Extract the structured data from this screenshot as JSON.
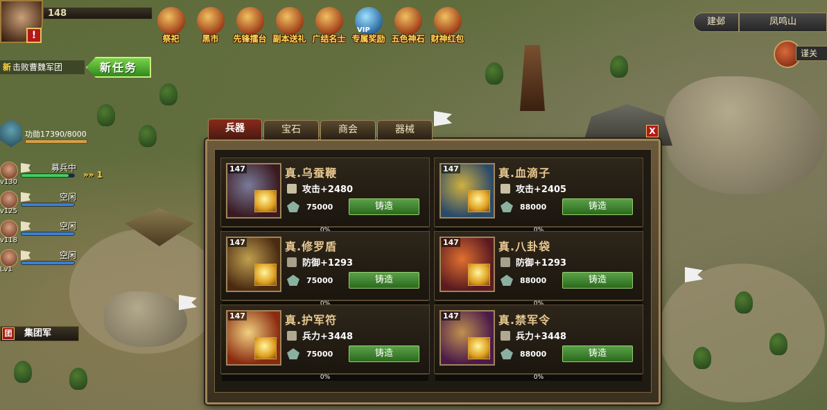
{
  "player": {
    "level": "148",
    "alert_icon": "!"
  },
  "top_icons": [
    {
      "label": "祭祀",
      "icon": "tripod-icon"
    },
    {
      "label": "黑市",
      "icon": "market-icon"
    },
    {
      "label": "先锋擂台",
      "icon": "arena-icon"
    },
    {
      "label": "副本送礼",
      "icon": "gift-icon"
    },
    {
      "label": "广结名士",
      "icon": "lantern-icon"
    },
    {
      "label": "专属奖励",
      "icon": "vip-icon",
      "badge": "VIP"
    },
    {
      "label": "五色神石",
      "icon": "crystal-icon"
    },
    {
      "label": "财神红包",
      "icon": "red-envelope-icon"
    }
  ],
  "location": {
    "button": "建邺",
    "name": "凤鸣山",
    "side_label": "谨关"
  },
  "task": {
    "new_tag": "新",
    "current": "击败曹魏军团",
    "new_task_button": "新任务"
  },
  "merit": {
    "label": "功勋17390/8000",
    "fill": 1.0
  },
  "armies": [
    {
      "level": "v130",
      "status": "募兵中",
      "fill": 0.9,
      "color": "#3fd060"
    },
    {
      "level": "v125",
      "status": "空闲",
      "fill": 1.0,
      "color": "#3a80d0"
    },
    {
      "level": "v118",
      "status": "空闲",
      "fill": 1.0,
      "color": "#3a80d0"
    },
    {
      "level": "Lv1",
      "status": "空闲",
      "fill": 1.0,
      "color": "#3a80d0"
    }
  ],
  "arrow_count": "1",
  "group_army": {
    "icon": "团",
    "label": "集团军"
  },
  "tabs": [
    "兵器",
    "宝石",
    "商会",
    "器械"
  ],
  "close": "X",
  "items": [
    {
      "level": "147",
      "name": "真.乌蚕鞭",
      "stat": "攻击+2480",
      "stat_icon": "sword-icon",
      "cost": "75000",
      "button": "铸造",
      "progress": "0%"
    },
    {
      "level": "147",
      "name": "真.血滴子",
      "stat": "攻击+2405",
      "stat_icon": "sword-icon",
      "cost": "88000",
      "button": "铸造",
      "progress": "0%"
    },
    {
      "level": "147",
      "name": "真.修罗盾",
      "stat": "防御+1293",
      "stat_icon": "shield-icon",
      "cost": "75000",
      "button": "铸造",
      "progress": "0%"
    },
    {
      "level": "147",
      "name": "真.八卦袋",
      "stat": "防御+1293",
      "stat_icon": "shield-icon",
      "cost": "88000",
      "button": "铸造",
      "progress": "0%"
    },
    {
      "level": "147",
      "name": "真.护军符",
      "stat": "兵力+3448",
      "stat_icon": "troop-icon",
      "cost": "75000",
      "button": "铸造",
      "progress": "0%"
    },
    {
      "level": "147",
      "name": "真.禁军令",
      "stat": "兵力+3448",
      "stat_icon": "troop-icon",
      "cost": "88000",
      "button": "铸造",
      "progress": "0%"
    }
  ]
}
